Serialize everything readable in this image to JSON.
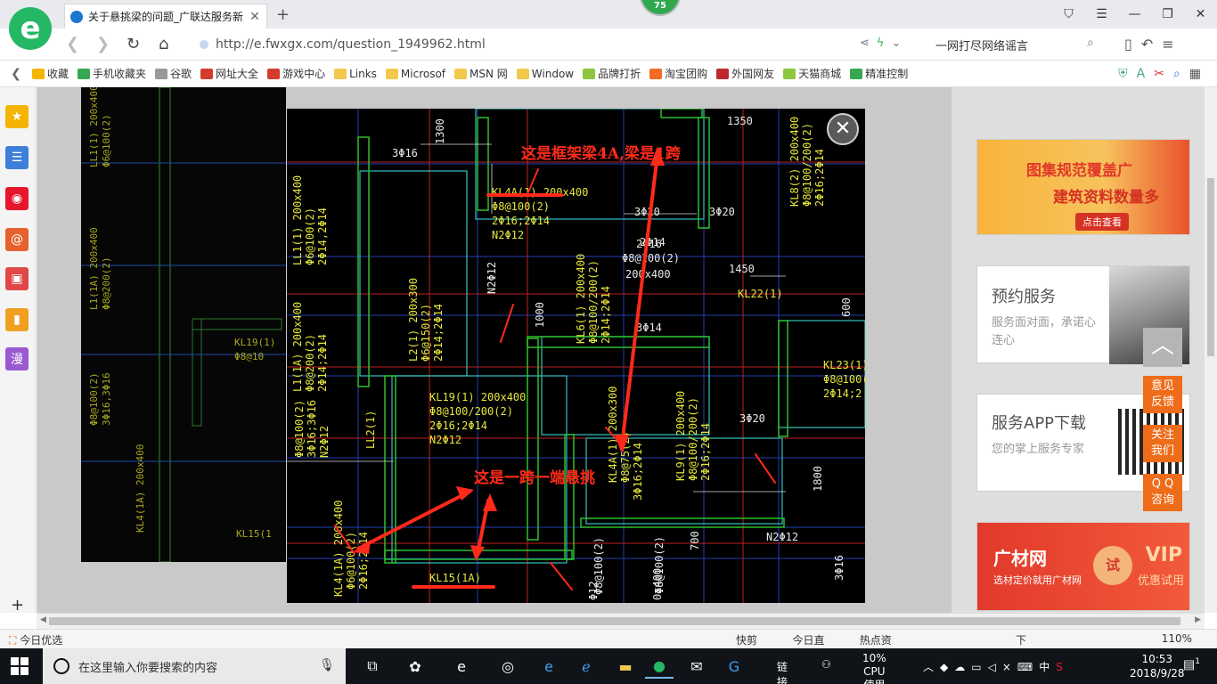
{
  "tabs": [
    {
      "title": "关于悬挑梁的问题_广联达服务新",
      "favicon": "globe-icon"
    }
  ],
  "badge_count": "75",
  "address": {
    "url": "http://e.fwxgx.com/question_1949962.html",
    "search_text": "一网打尽网络谣言"
  },
  "bookmarks": [
    {
      "label": "收藏",
      "color": "#f5b400"
    },
    {
      "label": "手机收藏夹",
      "color": "#36a852"
    },
    {
      "label": "谷歌",
      "color": "#999999"
    },
    {
      "label": "网址大全",
      "color": "#d33b2c"
    },
    {
      "label": "游戏中心",
      "color": "#d33b2c"
    },
    {
      "label": "Links",
      "color": "#f2c94c"
    },
    {
      "label": "Microsof",
      "color": "#f2c94c"
    },
    {
      "label": "MSN 网",
      "color": "#f2c94c"
    },
    {
      "label": "Window",
      "color": "#f2c94c"
    },
    {
      "label": "品牌打折",
      "color": "#8dc63f"
    },
    {
      "label": "淘宝团购",
      "color": "#f36c21"
    },
    {
      "label": "外国网友",
      "color": "#c0272d"
    },
    {
      "label": "天猫商城",
      "color": "#8dc63f"
    },
    {
      "label": "精准控制",
      "color": "#36a852"
    }
  ],
  "sidebar": [
    {
      "name": "favorites-icon",
      "glyph": "★",
      "color": "#f5b400"
    },
    {
      "name": "news-icon",
      "glyph": "☰",
      "color": "#3d7fd9"
    },
    {
      "name": "weibo-icon",
      "glyph": "◉",
      "color": "#e6162d"
    },
    {
      "name": "mail-icon",
      "glyph": "@",
      "color": "#e6612d"
    },
    {
      "name": "game-icon",
      "glyph": "▣",
      "color": "#e04848"
    },
    {
      "name": "book-icon",
      "glyph": "▮",
      "color": "#f0a020"
    },
    {
      "name": "comic-icon",
      "glyph": "漫",
      "color": "#9a59d1"
    }
  ],
  "page": {
    "ad_banner": {
      "line1": "图集规范覆盖广",
      "line2": "建筑资料数量多",
      "button": "点击查看"
    },
    "service": {
      "title": "预约服务",
      "subtitle": "服务面对面，承诺心连心"
    },
    "app_download": {
      "title": "服务APP下载",
      "subtitle": "您的掌上服务专家"
    },
    "ad2": {
      "brand": "广材网",
      "sub": "选材定价就用广材网",
      "vip": "VIP",
      "vip_sub": "优惠试用",
      "try": "试"
    },
    "float_buttons": [
      "意见\n反馈",
      "关注\n我们",
      "Q Q\n咨询"
    ]
  },
  "drawing": {
    "labels": [
      {
        "t": "这是框架梁4A,梁是1跨",
        "c": "red",
        "big": true
      },
      {
        "t": "这是一跨一端悬挑",
        "c": "red",
        "big": true
      },
      {
        "t": "KL4A(1) 200x400",
        "c": "y"
      },
      {
        "t": "Φ8@100(2)",
        "c": "y"
      },
      {
        "t": "2Φ16;2Φ14",
        "c": "y"
      },
      {
        "t": "N2Φ12",
        "c": "y"
      },
      {
        "t": "3Φ16",
        "c": "w"
      },
      {
        "t": "1300",
        "c": "w"
      },
      {
        "t": "1350",
        "c": "w"
      },
      {
        "t": "1450",
        "c": "w"
      },
      {
        "t": "1000",
        "c": "w"
      },
      {
        "t": "3Φ20",
        "c": "w"
      },
      {
        "t": "3Φ20",
        "c": "w"
      },
      {
        "t": "3Φ20",
        "c": "w"
      },
      {
        "t": "2Φ16",
        "c": "w"
      },
      {
        "t": "Φ8@100(2)",
        "c": "w"
      },
      {
        "t": "200x400",
        "c": "w"
      },
      {
        "t": "KL22(1)",
        "c": "y"
      },
      {
        "t": "KL23(1)",
        "c": "y"
      },
      {
        "t": "Φ8@100(2)",
        "c": "y"
      },
      {
        "t": "2Φ14;2",
        "c": "y"
      },
      {
        "t": "600",
        "c": "w"
      },
      {
        "t": "KL19(1) 200x400",
        "c": "y"
      },
      {
        "t": "Φ8@100/200(2)",
        "c": "y"
      },
      {
        "t": "2Φ16;2Φ14",
        "c": "y"
      },
      {
        "t": "N2Φ12",
        "c": "y"
      },
      {
        "t": "L1(1A) 200x400",
        "c": "y"
      },
      {
        "t": "Φ8@200(2)",
        "c": "y"
      },
      {
        "t": "2Φ14;2Φ14",
        "c": "y"
      },
      {
        "t": "L2(1) 200x300",
        "c": "y"
      },
      {
        "t": "Φ6@150(2)",
        "c": "y"
      },
      {
        "t": "2Φ14;2Φ14",
        "c": "y"
      },
      {
        "t": "LL1(1) 200x400",
        "c": "y"
      },
      {
        "t": "Φ6@100(2)",
        "c": "y"
      },
      {
        "t": "2Φ14,2Φ14",
        "c": "y"
      },
      {
        "t": "KL6(1) 200x400",
        "c": "y"
      },
      {
        "t": "Φ8@100/200(2)",
        "c": "y"
      },
      {
        "t": "2Φ14;2Φ14",
        "c": "y"
      },
      {
        "t": "KL8(2) 200x400",
        "c": "y"
      },
      {
        "t": "Φ8@100/200(2)",
        "c": "y"
      },
      {
        "t": "2Φ16;2Φ14",
        "c": "y"
      },
      {
        "t": "KL9(1) 200x400",
        "c": "y"
      },
      {
        "t": "Φ8@100/200(2)",
        "c": "y"
      },
      {
        "t": "2Φ16;2Φ14",
        "c": "y"
      },
      {
        "t": "KL4A(1) 200x300",
        "c": "y"
      },
      {
        "t": "Φ8@75(2)",
        "c": "y"
      },
      {
        "t": "3Φ16;2Φ14",
        "c": "y"
      },
      {
        "t": "Φ8@100(2)",
        "c": "y"
      },
      {
        "t": "3Φ16;3Φ16",
        "c": "y"
      },
      {
        "t": "N2Φ12",
        "c": "y"
      },
      {
        "t": "LL2(1)",
        "c": "y"
      },
      {
        "t": "KL15(1A)",
        "c": "y"
      },
      {
        "t": "KL4(1A) 200x400",
        "c": "y"
      },
      {
        "t": "Φ6@100(2)",
        "c": "y"
      },
      {
        "t": "2Φ16;2Φ14",
        "c": "y"
      },
      {
        "t": "3Φ14",
        "c": "w"
      },
      {
        "t": "2Φ14",
        "c": "w"
      },
      {
        "t": "N2Φ12",
        "c": "w"
      },
      {
        "t": "1800",
        "c": "w"
      },
      {
        "t": "700",
        "c": "w"
      },
      {
        "t": "N2Φ12",
        "c": "w"
      },
      {
        "t": "3Φ16",
        "c": "w"
      },
      {
        "t": "Φ8@100(2)",
        "c": "w"
      },
      {
        "t": "Φ12",
        "c": "w"
      },
      {
        "t": "Φ8@100(2)",
        "c": "w"
      },
      {
        "t": "0x400",
        "c": "w"
      }
    ]
  },
  "scrollbar": {
    "left": "◀",
    "right": "▶"
  },
  "statusbar": {
    "left": "今日优选",
    "items": [
      "快剪辑",
      "今日直播",
      "热点资讯",
      "下载",
      "110%"
    ]
  },
  "taskbar": {
    "search_placeholder": "在这里输入你要搜索的内容",
    "link_label": "链接",
    "cpu_percent": "10%",
    "cpu_label": "CPU使用",
    "ime": "中",
    "time": "10:53",
    "date": "2018/9/28",
    "notifications": "1"
  }
}
